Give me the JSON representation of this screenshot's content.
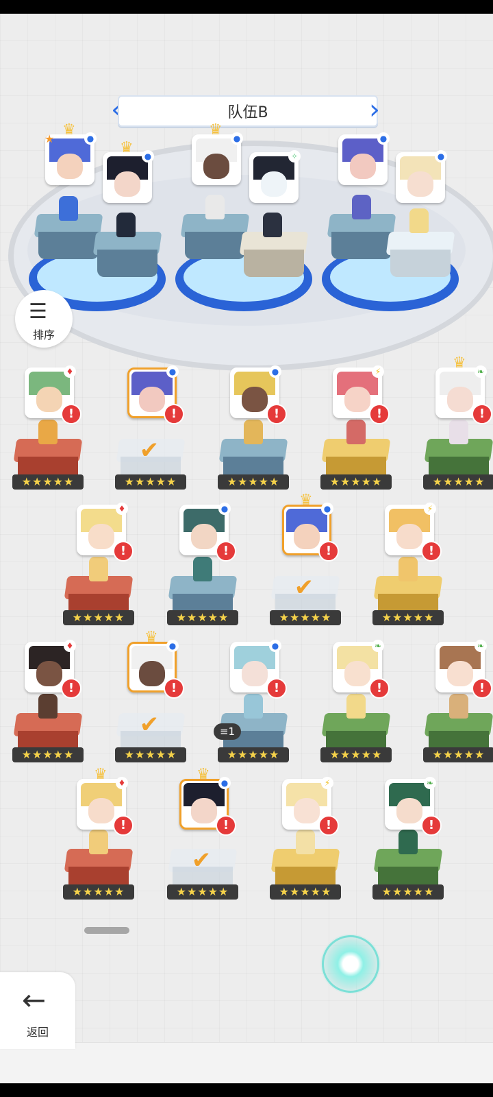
{
  "header": {
    "team_title": "队伍B"
  },
  "controls": {
    "sort_label": "排序",
    "back_label": "返回",
    "back_icon": "arrow-left-icon",
    "sort_icon": "sort-down-icon"
  },
  "overlay": {
    "count_badge": "1"
  },
  "stars_text": "★★★★★",
  "roster": {
    "rows": [
      [
        "red-fox-hero",
        "selected-purple-hero",
        "blue-dark-hero",
        "pink-hero",
        "green-white-hero"
      ],
      [
        "red-blonde-hero",
        "blue-teal-hero",
        "selected-crown-hero",
        "gold-blonde-hero"
      ],
      [
        "red-dark-hero",
        "selected-white-hair-hero",
        "blue-ice-hero",
        "green-blonde-hero",
        "green-brown-hero"
      ],
      [
        "red-crown-blonde-hero",
        "selected-crown-black-hero",
        "gold-cream-hero",
        "green-dark-hero"
      ]
    ]
  },
  "colors": {
    "accent_blue": "#2c6ee6",
    "alert_red": "#e53a3a",
    "selected_orange": "#f0a02a",
    "star_yellow": "#f5d24a"
  }
}
